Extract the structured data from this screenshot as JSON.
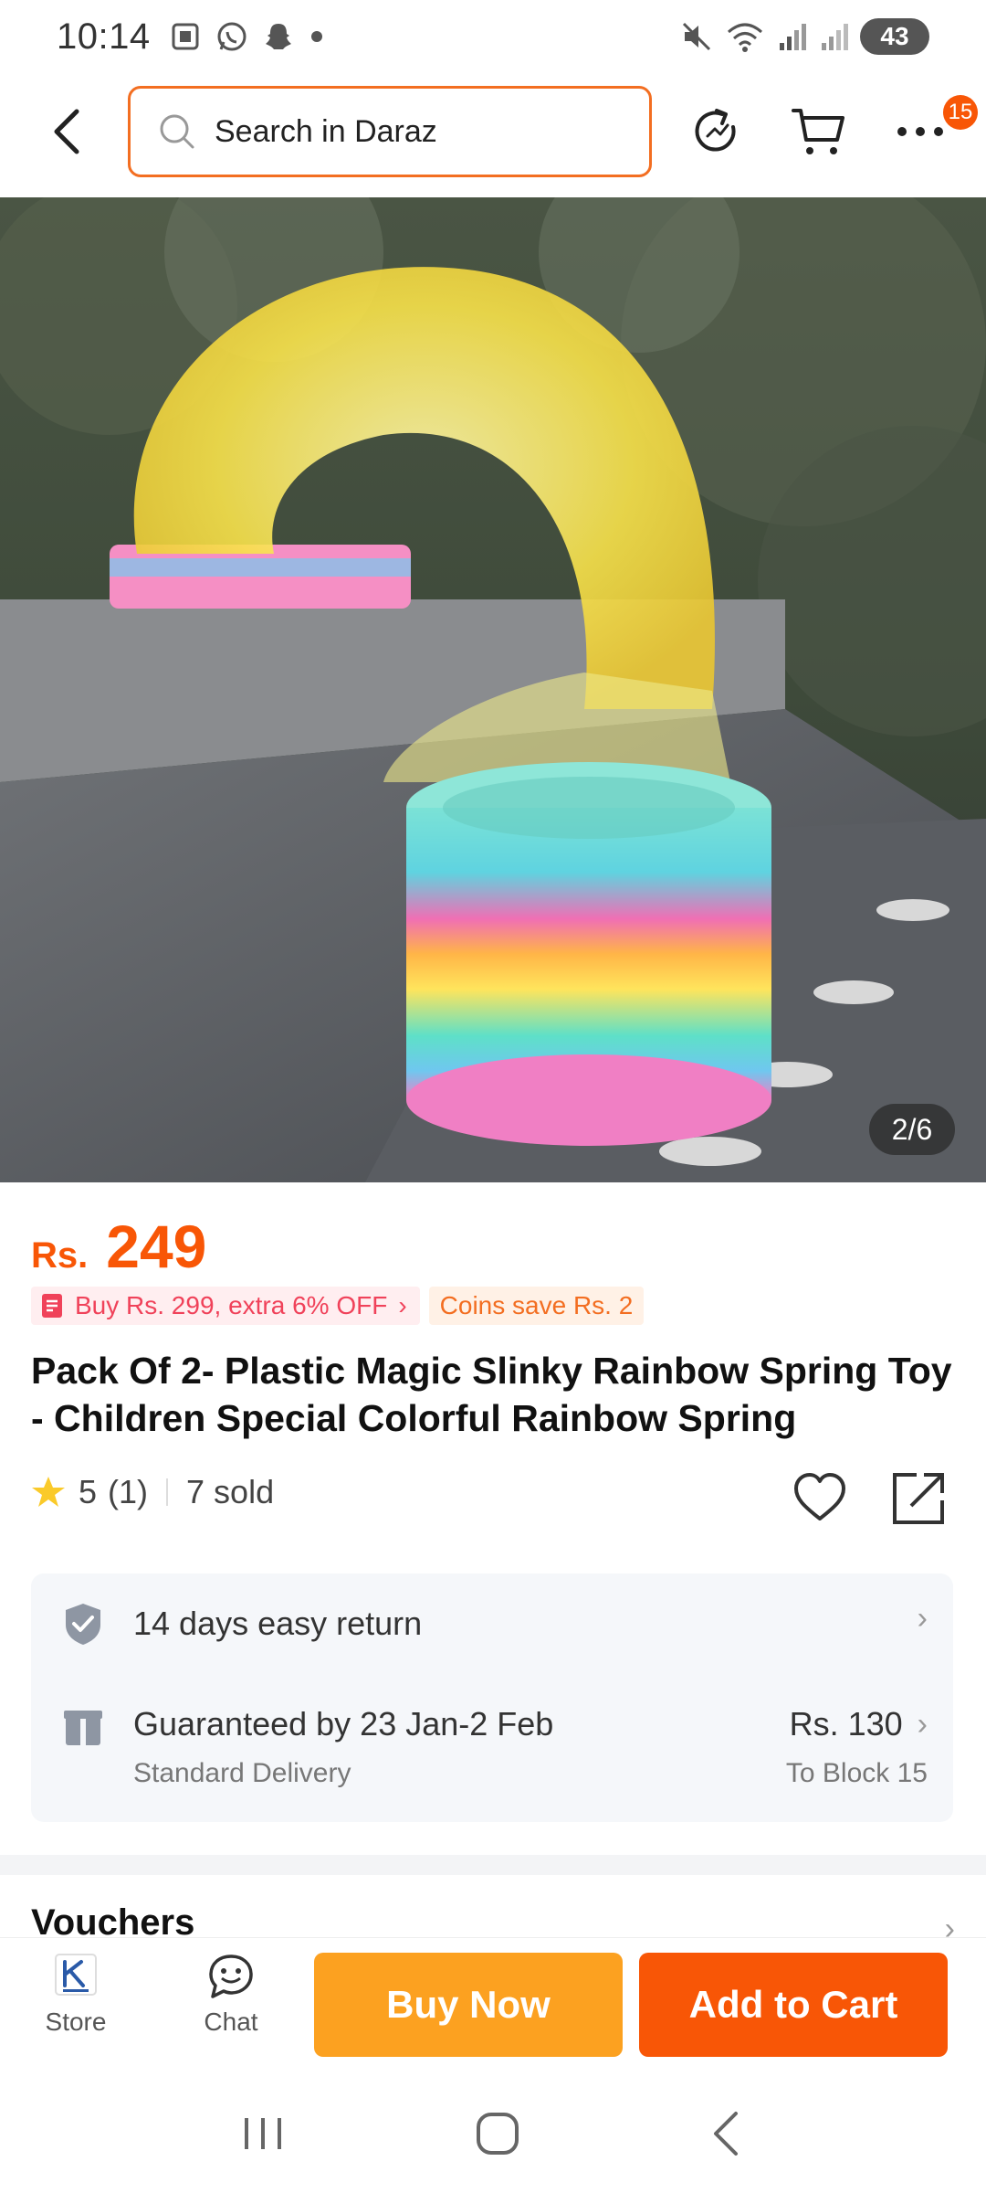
{
  "status_bar": {
    "time": "10:14",
    "battery": "43",
    "icons": [
      "screenshot-icon",
      "whatsapp-icon",
      "snapchat-icon",
      "dot-icon",
      "mute-icon",
      "wifi-icon",
      "signal-icon",
      "signal-icon-2"
    ]
  },
  "header": {
    "search_placeholder": "Search in Daraz",
    "cart_badge": "15",
    "icons": [
      "back-icon",
      "search-icon",
      "share-refresh-icon",
      "cart-icon",
      "more-icon"
    ]
  },
  "gallery": {
    "counter": "2/6",
    "current_index": 2,
    "total": 6
  },
  "product": {
    "currency": "Rs.",
    "price": "249",
    "promo": "Buy Rs. 299, extra 6% OFF",
    "coins": "Coins save Rs. 2",
    "title": "Pack Of 2- Plastic Magic Slinky Rainbow Spring Toy - Children Special Colorful Rainbow Spring",
    "rating": "5",
    "rating_count": "(1)",
    "sold": "7 sold"
  },
  "services": {
    "return": "14 days easy return",
    "delivery_title": "Guaranteed by 23 Jan-2 Feb",
    "delivery_sub": "Standard Delivery",
    "delivery_price": "Rs. 130",
    "delivery_to": "To Block 15"
  },
  "vouchers": {
    "label": "Vouchers"
  },
  "actions": {
    "store": "Store",
    "chat": "Chat",
    "buy_now": "Buy Now",
    "add_to_cart": "Add to Cart"
  },
  "colors": {
    "accent": "#f85606",
    "buy_now": "#fca120",
    "search_border": "#f36e21"
  }
}
